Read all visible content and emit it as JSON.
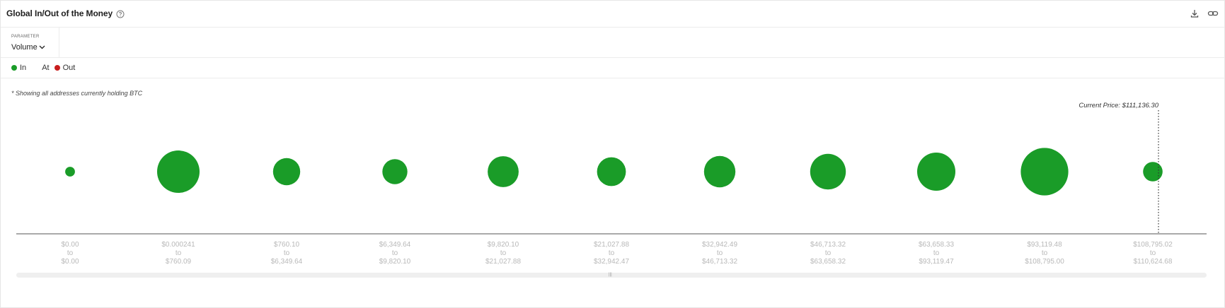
{
  "header": {
    "title": "Global In/Out of the Money",
    "help_icon": "help-circle-icon",
    "download_icon": "download-icon",
    "link_icon": "link-icon"
  },
  "parameter": {
    "label": "PARAMETER",
    "value": "Volume",
    "icon": "chevron-down-icon"
  },
  "legend": {
    "items": [
      {
        "label": "In",
        "color": "#1a9c28"
      },
      {
        "label": "At",
        "color": null
      },
      {
        "label": "Out",
        "color": "#c81d1d"
      }
    ]
  },
  "note": "* Showing all addresses currently holding BTC",
  "current_price_label": "Current Price: $111,136.30",
  "chart_data": {
    "type": "scatter",
    "subtype": "bubble",
    "series": [
      {
        "name": "In",
        "color": "#1a9c28"
      }
    ],
    "categories": [
      {
        "from": "$0.00",
        "to_word": "to",
        "to": "$0.00"
      },
      {
        "from": "$0.000241",
        "to_word": "to",
        "to": "$760.09"
      },
      {
        "from": "$760.10",
        "to_word": "to",
        "to": "$6,349.64"
      },
      {
        "from": "$6,349.64",
        "to_word": "to",
        "to": "$9,820.10"
      },
      {
        "from": "$9,820.10",
        "to_word": "to",
        "to": "$21,027.88"
      },
      {
        "from": "$21,027.88",
        "to_word": "to",
        "to": "$32,942.47"
      },
      {
        "from": "$32,942.49",
        "to_word": "to",
        "to": "$46,713.32"
      },
      {
        "from": "$46,713.32",
        "to_word": "to",
        "to": "$63,658.32"
      },
      {
        "from": "$63,658.33",
        "to_word": "to",
        "to": "$93,119.47"
      },
      {
        "from": "$93,119.48",
        "to_word": "to",
        "to": "$108,795.00"
      },
      {
        "from": "$108,795.02",
        "to_word": "to",
        "to": "$110,624.68"
      }
    ],
    "relative_volume": [
      0.23,
      1.0,
      0.64,
      0.59,
      0.73,
      0.68,
      0.74,
      0.84,
      0.9,
      1.12,
      0.46
    ],
    "status": [
      "In",
      "In",
      "In",
      "In",
      "In",
      "In",
      "In",
      "In",
      "In",
      "In",
      "In"
    ],
    "current_price": 111136.3,
    "grid": false,
    "legend_position": "top-left"
  }
}
